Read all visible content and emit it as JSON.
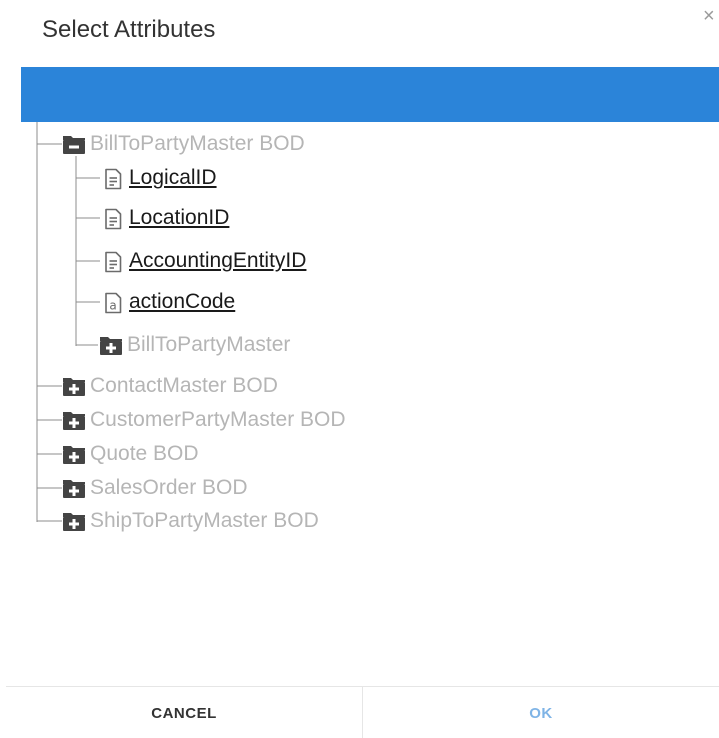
{
  "dialog": {
    "title": "Select Attributes",
    "close_glyph": "×",
    "header_bar_color": "#2b84d9"
  },
  "tree": {
    "root": {
      "label": "BillToPartyMaster BOD",
      "expanded": true,
      "icon": "folder-collapse-icon",
      "attributes": [
        {
          "label": "LogicalID",
          "icon": "text-document-icon"
        },
        {
          "label": "LocationID",
          "icon": "text-document-icon"
        },
        {
          "label": "AccountingEntityID",
          "icon": "text-document-icon"
        },
        {
          "label": "actionCode",
          "icon": "attribute-a-icon"
        }
      ],
      "child_folder": {
        "label": "BillToPartyMaster",
        "icon": "folder-expand-icon"
      }
    },
    "folders": [
      {
        "label": "ContactMaster BOD",
        "icon": "folder-expand-icon"
      },
      {
        "label": "CustomerPartyMaster BOD",
        "icon": "folder-expand-icon"
      },
      {
        "label": "Quote BOD",
        "icon": "folder-expand-icon"
      },
      {
        "label": "SalesOrder BOD",
        "icon": "folder-expand-icon"
      },
      {
        "label": "ShipToPartyMaster BOD",
        "icon": "folder-expand-icon"
      }
    ],
    "folder_label_color": "#b5b5b5",
    "folder_icon_color": "#444444",
    "line_color": "#8c8c8c"
  },
  "footer": {
    "cancel_label": "CANCEL",
    "ok_label": "OK",
    "cancel_color": "#333333",
    "ok_color": "#7fb4e6"
  }
}
